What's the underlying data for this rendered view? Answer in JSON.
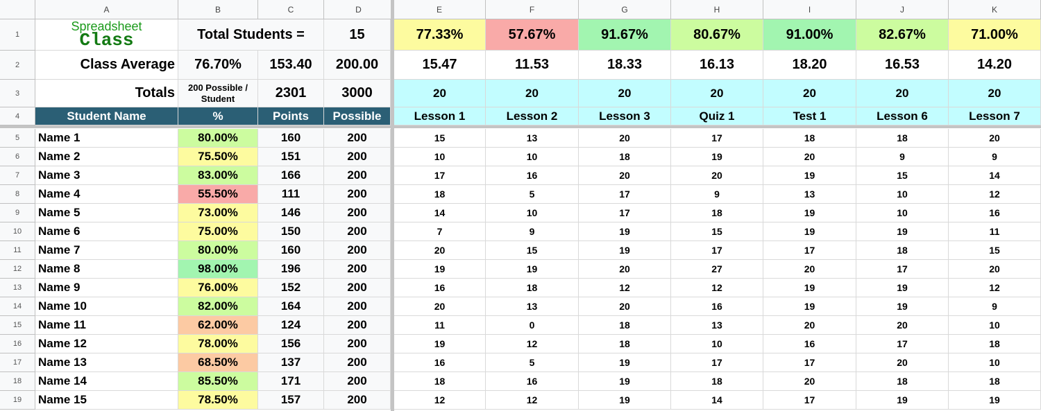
{
  "columns": [
    "A",
    "B",
    "C",
    "D",
    "E",
    "F",
    "G",
    "H",
    "I",
    "J",
    "K"
  ],
  "row_numbers": [
    "1",
    "2",
    "3",
    "4",
    "5",
    "6",
    "7",
    "8",
    "9",
    "10",
    "11",
    "12",
    "13",
    "14",
    "15",
    "16",
    "17",
    "18",
    "19"
  ],
  "logo": {
    "line1": "Spreadsheet",
    "line2": "Class"
  },
  "summary": {
    "total_students_label": "Total Students =",
    "total_students": "15",
    "class_average_label": "Class Average",
    "class_average_pct": "76.70%",
    "class_average_points": "153.40",
    "class_average_possible": "200.00",
    "totals_label": "Totals",
    "possible_note": "200 Possible / Student",
    "total_points": "2301",
    "total_possible": "3000"
  },
  "headers": {
    "name": "Student Name",
    "pct": "%",
    "points": "Points",
    "possible": "Possible"
  },
  "colors": {
    "green_strong": "#a2f5b0",
    "green_light": "#ccfc9f",
    "yellow": "#fdfb9f",
    "orange": "#fccaa3",
    "red": "#f9aaa8",
    "cyan": "#c2fdff",
    "header_dark": "#2b5f75"
  },
  "assignments": [
    {
      "name": "Lesson 1",
      "avg_pct": "77.33%",
      "avg_pts": "15.47",
      "possible": "20",
      "color": "yellow"
    },
    {
      "name": "Lesson 2",
      "avg_pct": "57.67%",
      "avg_pts": "11.53",
      "possible": "20",
      "color": "red"
    },
    {
      "name": "Lesson 3",
      "avg_pct": "91.67%",
      "avg_pts": "18.33",
      "possible": "20",
      "color": "green_strong"
    },
    {
      "name": "Quiz 1",
      "avg_pct": "80.67%",
      "avg_pts": "16.13",
      "possible": "20",
      "color": "green_light"
    },
    {
      "name": "Test 1",
      "avg_pct": "91.00%",
      "avg_pts": "18.20",
      "possible": "20",
      "color": "green_strong"
    },
    {
      "name": "Lesson 6",
      "avg_pct": "82.67%",
      "avg_pts": "16.53",
      "possible": "20",
      "color": "green_light"
    },
    {
      "name": "Lesson 7",
      "avg_pct": "71.00%",
      "avg_pts": "14.20",
      "possible": "20",
      "color": "yellow"
    }
  ],
  "students": [
    {
      "name": "Name 1",
      "pct": "80.00%",
      "points": "160",
      "possible": "200",
      "color": "green_light",
      "scores": [
        "15",
        "13",
        "20",
        "17",
        "18",
        "18",
        "20"
      ]
    },
    {
      "name": "Name 2",
      "pct": "75.50%",
      "points": "151",
      "possible": "200",
      "color": "yellow",
      "scores": [
        "10",
        "10",
        "18",
        "19",
        "20",
        "9",
        "9"
      ]
    },
    {
      "name": "Name 3",
      "pct": "83.00%",
      "points": "166",
      "possible": "200",
      "color": "green_light",
      "scores": [
        "17",
        "16",
        "20",
        "20",
        "19",
        "15",
        "14"
      ]
    },
    {
      "name": "Name 4",
      "pct": "55.50%",
      "points": "111",
      "possible": "200",
      "color": "red",
      "scores": [
        "18",
        "5",
        "17",
        "9",
        "13",
        "10",
        "12"
      ]
    },
    {
      "name": "Name 5",
      "pct": "73.00%",
      "points": "146",
      "possible": "200",
      "color": "yellow",
      "scores": [
        "14",
        "10",
        "17",
        "18",
        "19",
        "10",
        "16"
      ]
    },
    {
      "name": "Name 6",
      "pct": "75.00%",
      "points": "150",
      "possible": "200",
      "color": "yellow",
      "scores": [
        "7",
        "9",
        "19",
        "15",
        "19",
        "19",
        "11"
      ]
    },
    {
      "name": "Name 7",
      "pct": "80.00%",
      "points": "160",
      "possible": "200",
      "color": "green_light",
      "scores": [
        "20",
        "15",
        "19",
        "17",
        "17",
        "18",
        "15"
      ]
    },
    {
      "name": "Name 8",
      "pct": "98.00%",
      "points": "196",
      "possible": "200",
      "color": "green_strong",
      "scores": [
        "19",
        "19",
        "20",
        "27",
        "20",
        "17",
        "20"
      ]
    },
    {
      "name": "Name 9",
      "pct": "76.00%",
      "points": "152",
      "possible": "200",
      "color": "yellow",
      "scores": [
        "16",
        "18",
        "12",
        "12",
        "19",
        "19",
        "12"
      ]
    },
    {
      "name": "Name 10",
      "pct": "82.00%",
      "points": "164",
      "possible": "200",
      "color": "green_light",
      "scores": [
        "20",
        "13",
        "20",
        "16",
        "19",
        "19",
        "9"
      ]
    },
    {
      "name": "Name 11",
      "pct": "62.00%",
      "points": "124",
      "possible": "200",
      "color": "orange",
      "scores": [
        "11",
        "0",
        "18",
        "13",
        "20",
        "20",
        "10"
      ]
    },
    {
      "name": "Name 12",
      "pct": "78.00%",
      "points": "156",
      "possible": "200",
      "color": "yellow",
      "scores": [
        "19",
        "12",
        "18",
        "10",
        "16",
        "17",
        "18"
      ]
    },
    {
      "name": "Name 13",
      "pct": "68.50%",
      "points": "137",
      "possible": "200",
      "color": "orange",
      "scores": [
        "16",
        "5",
        "19",
        "17",
        "17",
        "20",
        "10"
      ]
    },
    {
      "name": "Name 14",
      "pct": "85.50%",
      "points": "171",
      "possible": "200",
      "color": "green_light",
      "scores": [
        "18",
        "16",
        "19",
        "18",
        "20",
        "18",
        "18"
      ]
    },
    {
      "name": "Name 15",
      "pct": "78.50%",
      "points": "157",
      "possible": "200",
      "color": "yellow",
      "scores": [
        "12",
        "12",
        "19",
        "14",
        "17",
        "19",
        "19"
      ]
    }
  ]
}
